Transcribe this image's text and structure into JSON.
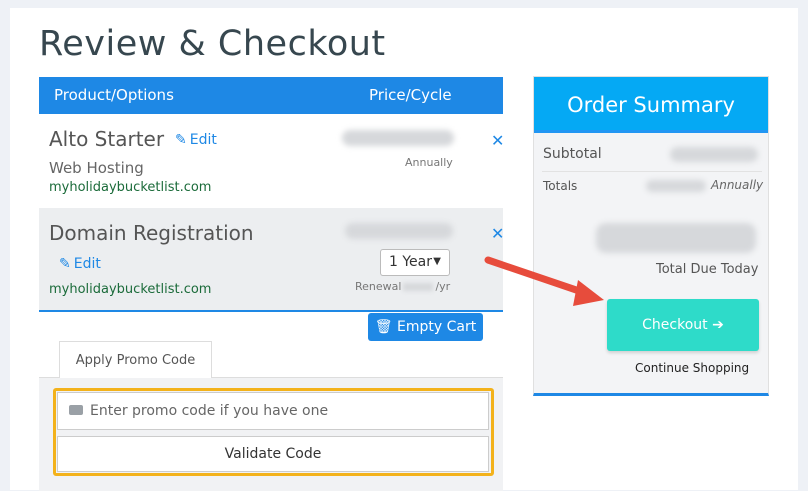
{
  "page": {
    "title": "Review & Checkout"
  },
  "cart": {
    "headers": {
      "product": "Product/Options",
      "price": "Price/Cycle"
    },
    "items": [
      {
        "name": "Alto Starter",
        "edit_label": "Edit",
        "subtitle": "Web Hosting",
        "domain": "myholidaybucketlist.com",
        "cycle": "Annually",
        "remove_icon": "close-icon"
      },
      {
        "name": "Domain Registration",
        "edit_label": "Edit",
        "domain": "myholidaybucketlist.com",
        "period_selected": "1 Year",
        "renewal_prefix": "Renewal",
        "renewal_suffix": "/yr",
        "remove_icon": "close-icon"
      }
    ],
    "empty_cart_label": "Empty Cart"
  },
  "promo": {
    "tab_label": "Apply Promo Code",
    "placeholder": "Enter promo code if you have one",
    "validate_label": "Validate Code"
  },
  "summary": {
    "title": "Order Summary",
    "subtotal_label": "Subtotal",
    "totals_label": "Totals",
    "totals_cycle": "Annually",
    "total_due_label": "Total Due Today",
    "checkout_label": "Checkout",
    "continue_label": "Continue Shopping"
  },
  "colors": {
    "primary_blue": "#1e88e5",
    "summary_header": "#05a9f4",
    "checkout_teal": "#2edbc9",
    "highlight_yellow": "#f3b21b",
    "annotation_arrow": "#e74c3c"
  }
}
